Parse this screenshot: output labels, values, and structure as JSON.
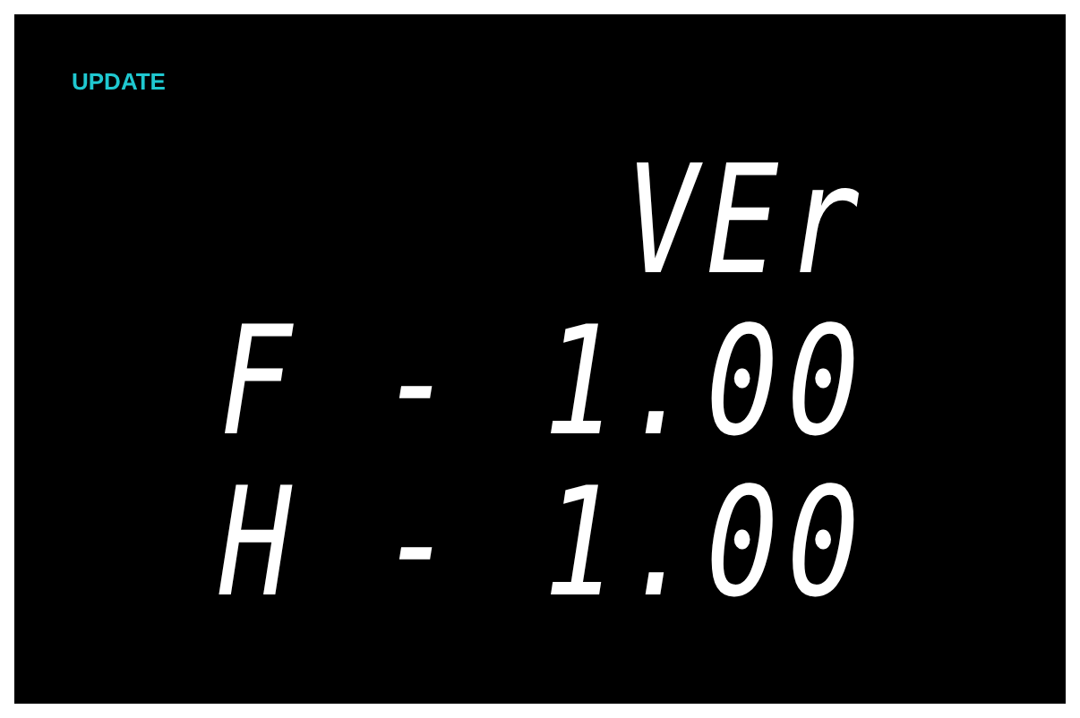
{
  "screen": {
    "mode_label": "UPDATE",
    "lines": [
      "VEr",
      "F - 1.00",
      "H - 1.00"
    ]
  }
}
